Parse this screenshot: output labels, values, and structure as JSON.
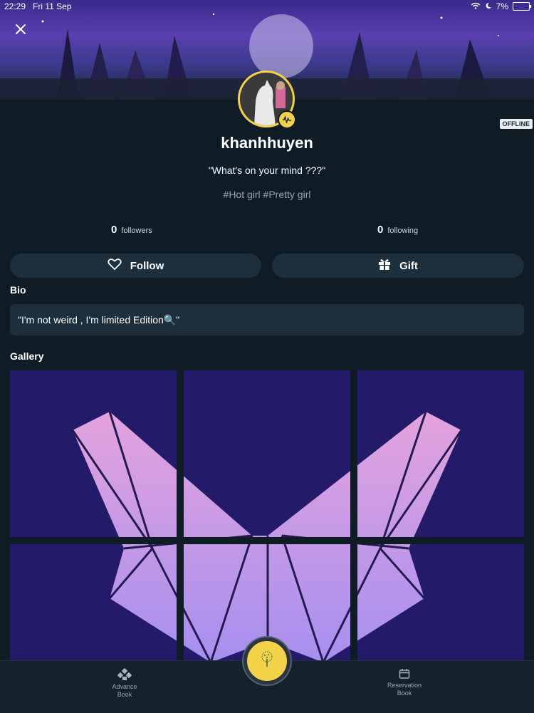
{
  "status_bar": {
    "time": "22:29",
    "date": "Fri 11 Sep",
    "battery": "7%"
  },
  "profile": {
    "username": "khanhhuyen",
    "status_message": "\"What's on your mind ???\"",
    "tags": "#Hot girl #Pretty girl",
    "presence": "OFFLINE"
  },
  "stats": {
    "followers_count": "0",
    "followers_label": "followers",
    "following_count": "0",
    "following_label": "following"
  },
  "actions": {
    "follow_label": "Follow",
    "gift_label": "Gift"
  },
  "bio": {
    "title": "Bio",
    "text": "\"I'm not weird , I'm limited Edition🔍\""
  },
  "gallery": {
    "title": "Gallery"
  },
  "bottom_nav": {
    "left_label_1": "Advance",
    "left_label_2": "Book",
    "right_label_1": "Reservation",
    "right_label_2": "Book"
  },
  "colors": {
    "accent": "#f3d24a",
    "panel": "#1d2e3d",
    "background": "#0f1b25"
  }
}
